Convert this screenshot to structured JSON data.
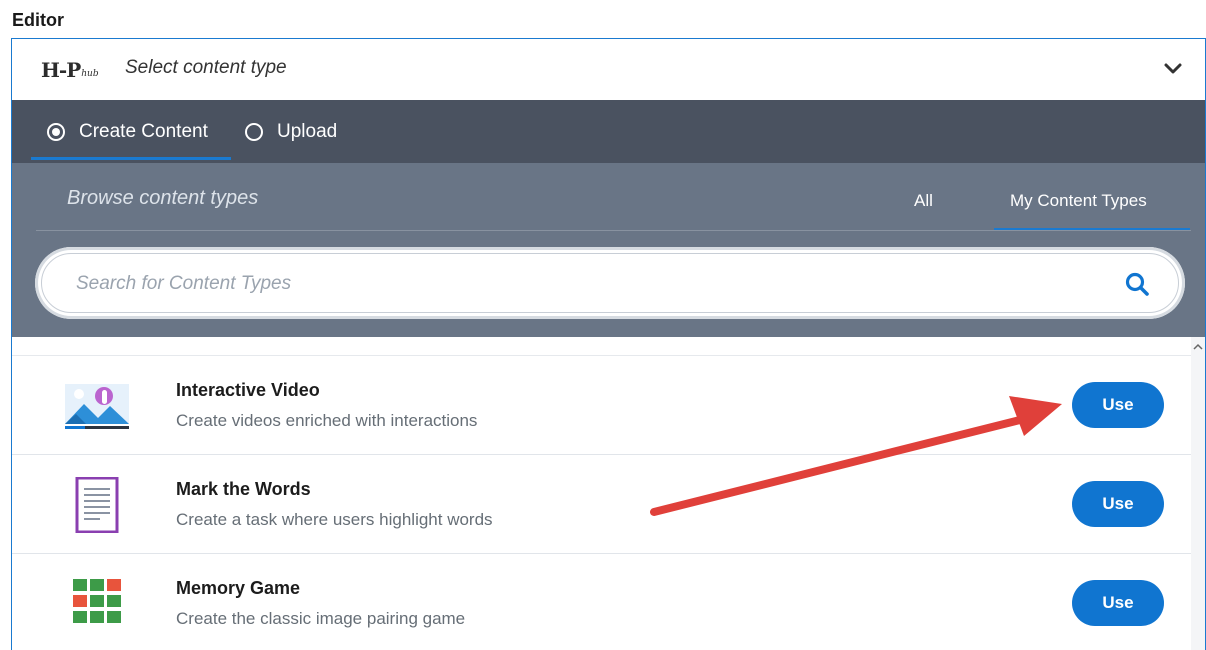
{
  "editor": {
    "label": "Editor"
  },
  "hub": {
    "logo_main": "H-P",
    "logo_sub": "hub",
    "title": "Select content type"
  },
  "tabs": [
    {
      "label": "Create Content",
      "selected": true
    },
    {
      "label": "Upload",
      "selected": false
    }
  ],
  "browse": {
    "title": "Browse content types",
    "filters": [
      {
        "label": "All",
        "active": false
      },
      {
        "label": "My Content Types",
        "active": true
      }
    ]
  },
  "search": {
    "placeholder": "Search for Content Types",
    "value": ""
  },
  "content_types": [
    {
      "title": "Interactive Video",
      "description": "Create videos enriched with interactions",
      "button": "Use",
      "icon": "interactive-video-icon"
    },
    {
      "title": "Mark the Words",
      "description": "Create a task where users highlight words",
      "button": "Use",
      "icon": "mark-the-words-icon"
    },
    {
      "title": "Memory Game",
      "description": "Create the classic image pairing game",
      "button": "Use",
      "icon": "memory-game-icon"
    }
  ],
  "colors": {
    "accent": "#1075d0",
    "tabbar": "#4a5260",
    "browse": "#697586",
    "annotation_arrow": "#e0403a"
  }
}
